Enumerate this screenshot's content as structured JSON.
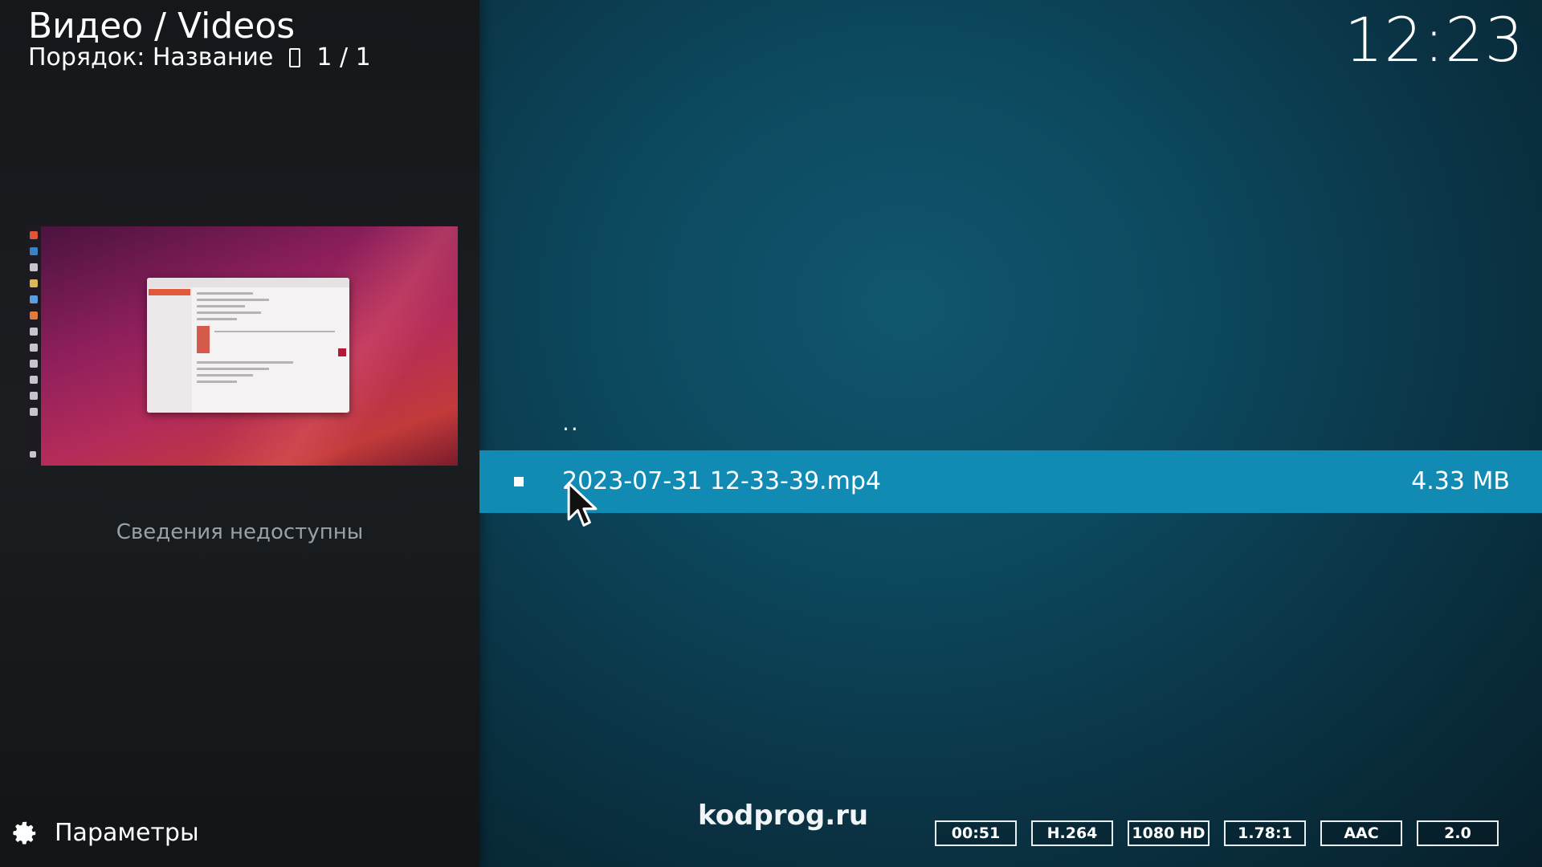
{
  "header": {
    "title": "Видео / Videos",
    "sort_label": "Порядок: Название",
    "page_counter": "1 / 1"
  },
  "clock": "12:23",
  "info_panel": {
    "no_info_text": "Сведения недоступны"
  },
  "settings": {
    "label": "Параметры",
    "icon": "gear-icon"
  },
  "list": {
    "parent_item": "..",
    "items": [
      {
        "name": "2023-07-31 12-33-39.mp4",
        "size": "4.33 MB",
        "selected": true
      }
    ]
  },
  "watermark": "kodprog.ru",
  "media_flags": [
    "00:51",
    "H.264",
    "1080 HD",
    "1.78:1",
    "AAC",
    "2.0"
  ],
  "colors": {
    "selection": "#128bb4",
    "background": "#0b3a4c",
    "sidebar": "#181c1f"
  }
}
